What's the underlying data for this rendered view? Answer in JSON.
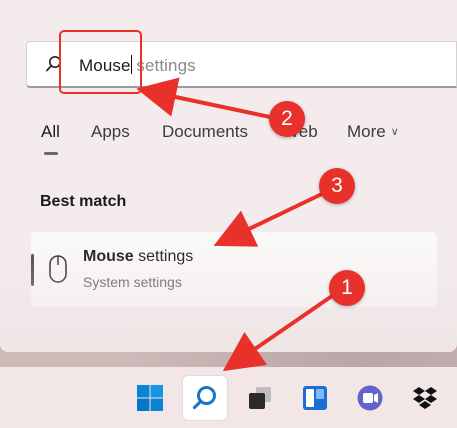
{
  "search": {
    "typed_text": "Mouse",
    "suggestion_text": "settings"
  },
  "tabs": [
    {
      "label": "All",
      "active": true
    },
    {
      "label": "Apps",
      "active": false
    },
    {
      "label": "Documents",
      "active": false
    },
    {
      "label": "Web",
      "active": false
    },
    {
      "label": "More",
      "active": false
    }
  ],
  "section_title": "Best match",
  "result": {
    "title_bold": "Mouse",
    "title_rest": " settings",
    "subtitle": "System settings",
    "icon": "mouse-icon"
  },
  "taskbar": {
    "items": [
      {
        "name": "windows-start-icon"
      },
      {
        "name": "search-icon",
        "active": true
      },
      {
        "name": "task-view-icon"
      },
      {
        "name": "widgets-icon"
      },
      {
        "name": "teams-chat-icon"
      },
      {
        "name": "dropbox-icon"
      }
    ]
  },
  "annotations": {
    "badges": [
      "1",
      "2",
      "3"
    ],
    "color": "#e8312a"
  }
}
